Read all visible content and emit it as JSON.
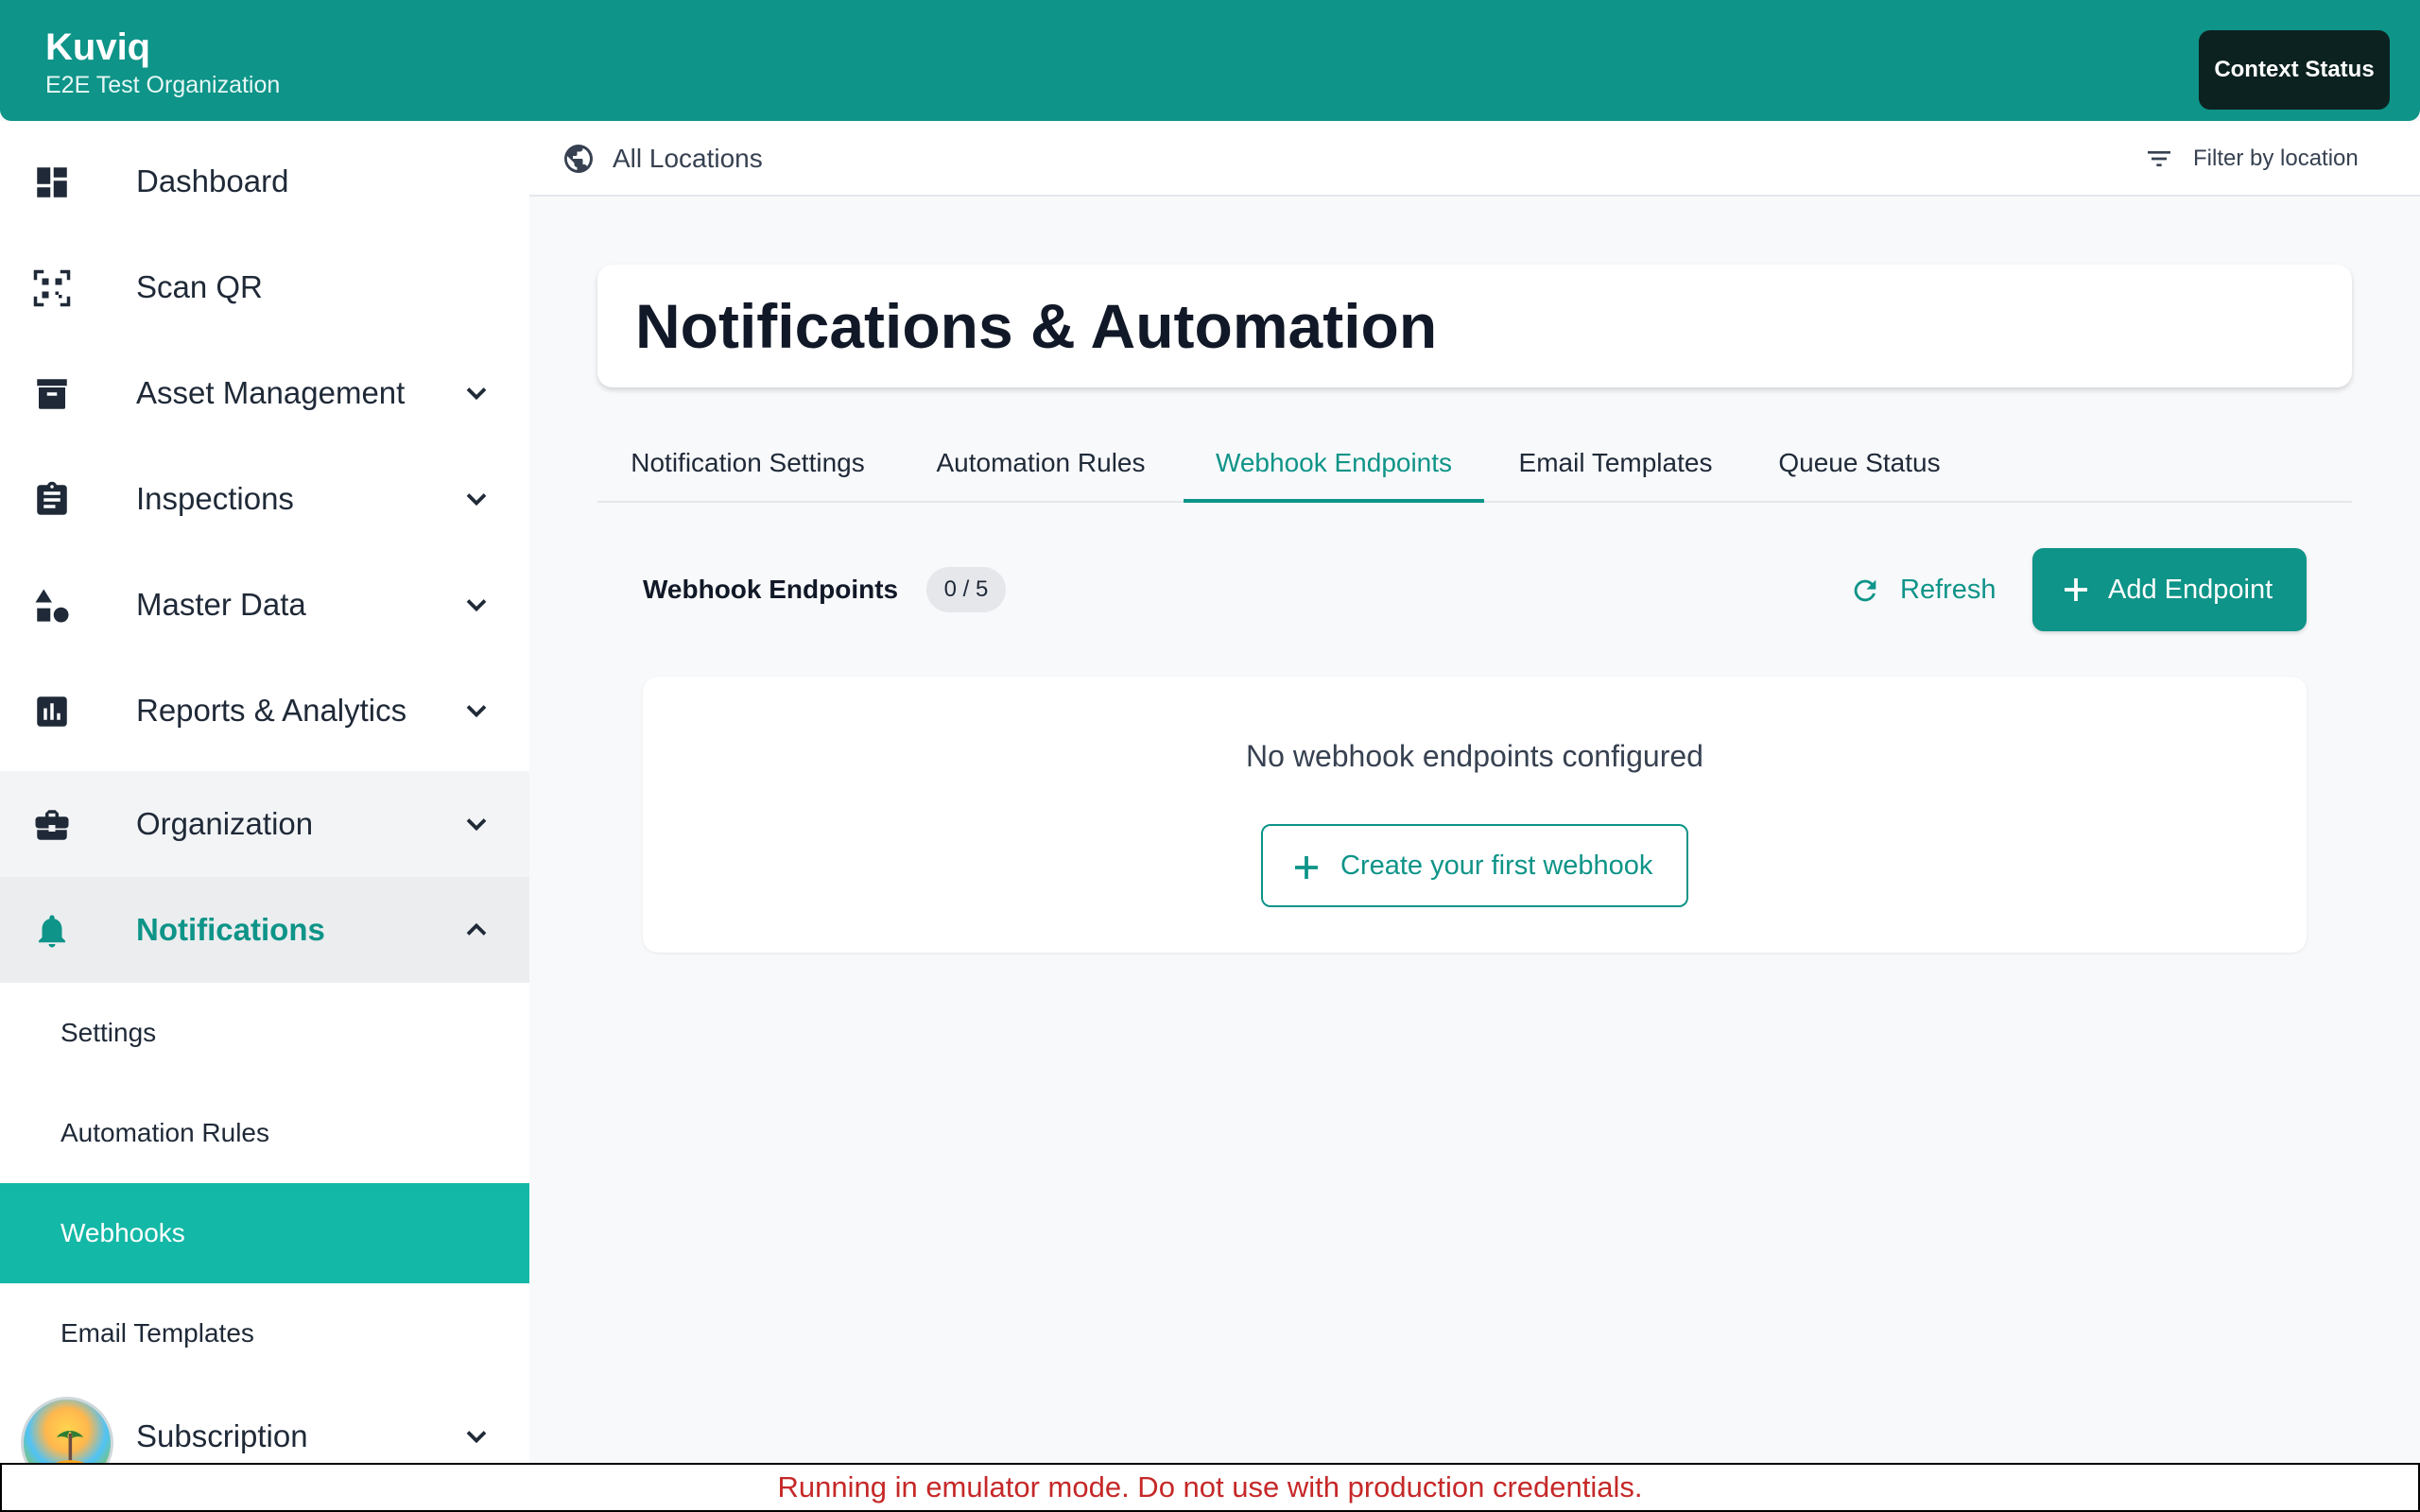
{
  "header": {
    "app_name": "Kuviq",
    "org_name": "E2E Test Organization",
    "context_button": "Context Status"
  },
  "sidebar": {
    "items": [
      {
        "label": "Dashboard",
        "icon": "dashboard-icon"
      },
      {
        "label": "Scan QR",
        "icon": "qr-scan-icon"
      },
      {
        "label": "Asset Management",
        "icon": "archive-icon",
        "expandable": true
      },
      {
        "label": "Inspections",
        "icon": "clipboard-icon",
        "expandable": true
      },
      {
        "label": "Master Data",
        "icon": "shapes-icon",
        "expandable": true
      },
      {
        "label": "Reports & Analytics",
        "icon": "bar-chart-icon",
        "expandable": true
      },
      {
        "label": "Organization",
        "icon": "briefcase-icon",
        "expandable": true
      },
      {
        "label": "Notifications",
        "icon": "bell-icon",
        "expandable": true,
        "expanded": true,
        "active": true
      },
      {
        "label": "Subscription",
        "icon": "avatar",
        "expandable": true
      }
    ],
    "notifications_subitems": [
      {
        "label": "Settings"
      },
      {
        "label": "Automation Rules"
      },
      {
        "label": "Webhooks",
        "active": true
      },
      {
        "label": "Email Templates"
      }
    ]
  },
  "topbar": {
    "location_label": "All Locations",
    "filter_label": "Filter by location"
  },
  "main": {
    "page_title": "Notifications & Automation",
    "tabs": [
      {
        "label": "Notification Settings"
      },
      {
        "label": "Automation Rules"
      },
      {
        "label": "Webhook Endpoints",
        "active": true
      },
      {
        "label": "Email Templates"
      },
      {
        "label": "Queue Status"
      }
    ],
    "section": {
      "title": "Webhook Endpoints",
      "count_badge": "0 / 5",
      "refresh_label": "Refresh",
      "add_label": "Add Endpoint"
    },
    "empty_state": {
      "message": "No webhook endpoints configured",
      "create_label": "Create your first webhook"
    }
  },
  "banner": {
    "text": "Running in emulator mode. Do not use with production credentials."
  },
  "colors": {
    "primary": "#0e9488",
    "active_sub": "#14b8a6",
    "banner_text": "#c62828"
  }
}
